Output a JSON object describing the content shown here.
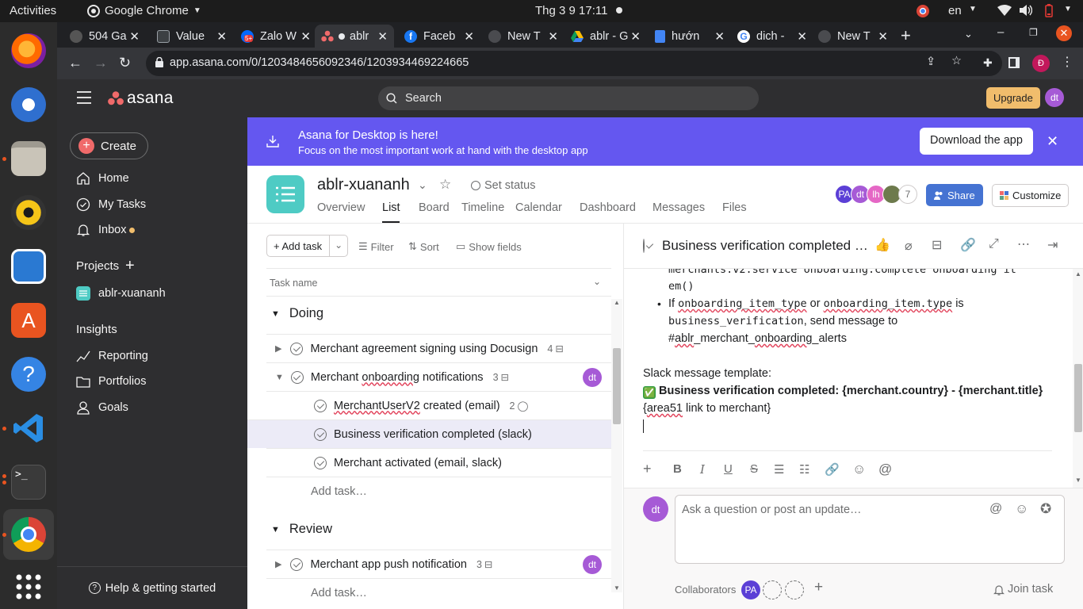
{
  "os": {
    "activities": "Activities",
    "app_name": "Google Chrome",
    "clock": "Thg 3 9  17:11",
    "lang": "en"
  },
  "dock": {
    "items": [
      "firefox-icon",
      "thunderbird-icon",
      "files-icon",
      "rhythmbox-icon",
      "libreoffice-writer-icon",
      "software-center-icon",
      "help-icon",
      "vscode-icon",
      "terminal-icon",
      "chrome-icon",
      "app-grid-icon"
    ]
  },
  "browser": {
    "tabs": [
      {
        "label": "504 Ga",
        "icon": "github-icon"
      },
      {
        "label": "Value",
        "icon": "terminal-tab-icon"
      },
      {
        "label": "Zalo W",
        "icon": "zalo-icon",
        "badge": "5+"
      },
      {
        "label": "ablr",
        "icon": "asana-icon",
        "active": true
      },
      {
        "label": "Faceb",
        "icon": "facebook-icon"
      },
      {
        "label": "New T",
        "icon": "newtab-icon"
      },
      {
        "label": "ablr - G",
        "icon": "drive-icon"
      },
      {
        "label": "hướn",
        "icon": "docs-icon"
      },
      {
        "label": "dich -",
        "icon": "google-icon"
      },
      {
        "label": "New T",
        "icon": "newtab-icon"
      }
    ],
    "url": "app.asana.com/0/1203484656092346/1203934469224665",
    "profile_initial": "Đ"
  },
  "asana": {
    "logo": "asana",
    "search_placeholder": "Search",
    "upgrade": "Upgrade",
    "user_initials": "dt"
  },
  "sidebar": {
    "create": "Create",
    "nav": [
      "Home",
      "My Tasks",
      "Inbox"
    ],
    "projects_heading": "Projects",
    "project": "ablr-xuananh",
    "insights_heading": "Insights",
    "insights": [
      "Reporting",
      "Portfolios",
      "Goals"
    ],
    "help": "Help & getting started"
  },
  "banner": {
    "title": "Asana for Desktop is here!",
    "subtitle": "Focus on the most important work at hand with the desktop app",
    "button": "Download the app"
  },
  "project": {
    "name": "ablr-xuananh",
    "set_status": "Set status",
    "tabs": [
      "Overview",
      "List",
      "Board",
      "Timeline",
      "Calendar",
      "Dashboard",
      "Messages",
      "Files"
    ],
    "active_tab": "List",
    "members": [
      {
        "initials": "PA",
        "color": "#5b3fd6"
      },
      {
        "initials": "dt",
        "color": "#a65ad6"
      },
      {
        "initials": "lh",
        "color": "#e567c5"
      },
      {
        "initials": "",
        "color": "#6d7a4c"
      }
    ],
    "member_count": "7",
    "share": "Share",
    "customize": "Customize"
  },
  "list": {
    "add_task": "Add task",
    "filter": "Filter",
    "sort": "Sort",
    "show_fields": "Show fields",
    "column": "Task name",
    "sections": [
      {
        "name": "Doing"
      },
      {
        "name": "Review"
      }
    ],
    "tasks": {
      "t1": {
        "name": "Merchant agreement signing using Docusign",
        "subtasks": "4"
      },
      "t2": {
        "name": "Merchant onboarding notifications",
        "subtasks": "3",
        "assignee": "dt"
      },
      "t2a": {
        "name": "MerchantUserV2 created (email)",
        "comments": "2"
      },
      "t2b": {
        "name": "Business verification completed (slack)"
      },
      "t2c": {
        "name": "Merchant activated (email, slack)"
      },
      "t3": {
        "name": "Merchant app push notification",
        "subtasks": "3",
        "assignee": "dt"
      }
    },
    "add_task_inline": "Add task…"
  },
  "detail": {
    "title": "Business verification completed …",
    "code_line1": "merchants.v2.service onboarding.complete onboarding it",
    "code_line2": "em()",
    "bullet_if": "If ",
    "bullet_code1": "onboarding_item_type",
    "bullet_or": " or ",
    "bullet_code2": "onboarding_item.type",
    "bullet_is": " is",
    "bullet_code3": "business_verification",
    "bullet_send": ", send message to",
    "channel_prefix": "#",
    "channel_ablr": "ablr",
    "channel_mid": "_merchant_",
    "channel_onb": "onboarding",
    "channel_suffix": "_alerts",
    "template_label": "Slack message template:",
    "check_emoji": "✅",
    "template_bold": "Business verification completed: {merchant.country} - {merchant.title}",
    "link_open": "{",
    "link_area": "area51",
    "link_rest": " link to merchant}",
    "comment_placeholder": "Ask a question or post an update…",
    "collaborators": "Collaborators",
    "collab_initials": "PA",
    "join_task": "Join task",
    "commenter": "dt"
  }
}
